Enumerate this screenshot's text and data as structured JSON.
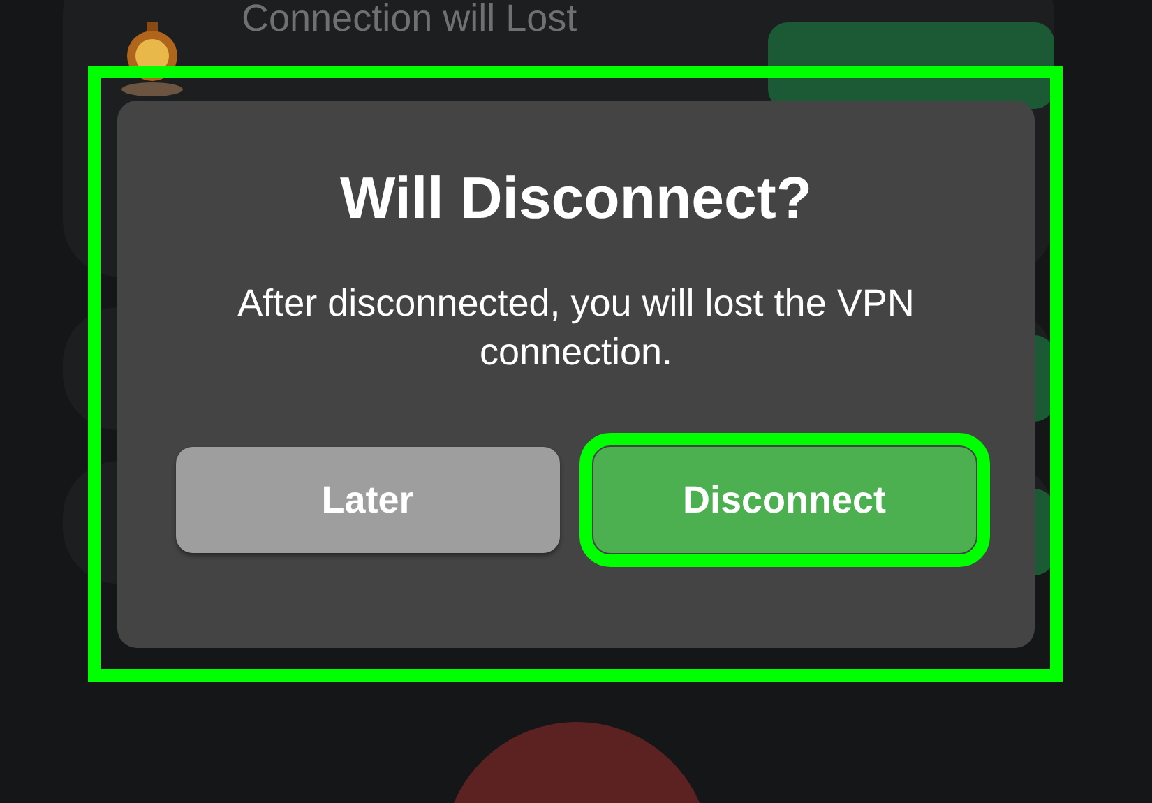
{
  "timer_card": {
    "title": "Connection will Lost"
  },
  "dialog": {
    "title": "Will Disconnect?",
    "message": "After disconnected, you will lost the VPN connection.",
    "highlighted": true,
    "buttons": [
      {
        "label": "Later",
        "kind": "secondary",
        "highlighted": false
      },
      {
        "label": "Disconnect",
        "kind": "primary",
        "highlighted": true
      }
    ]
  }
}
